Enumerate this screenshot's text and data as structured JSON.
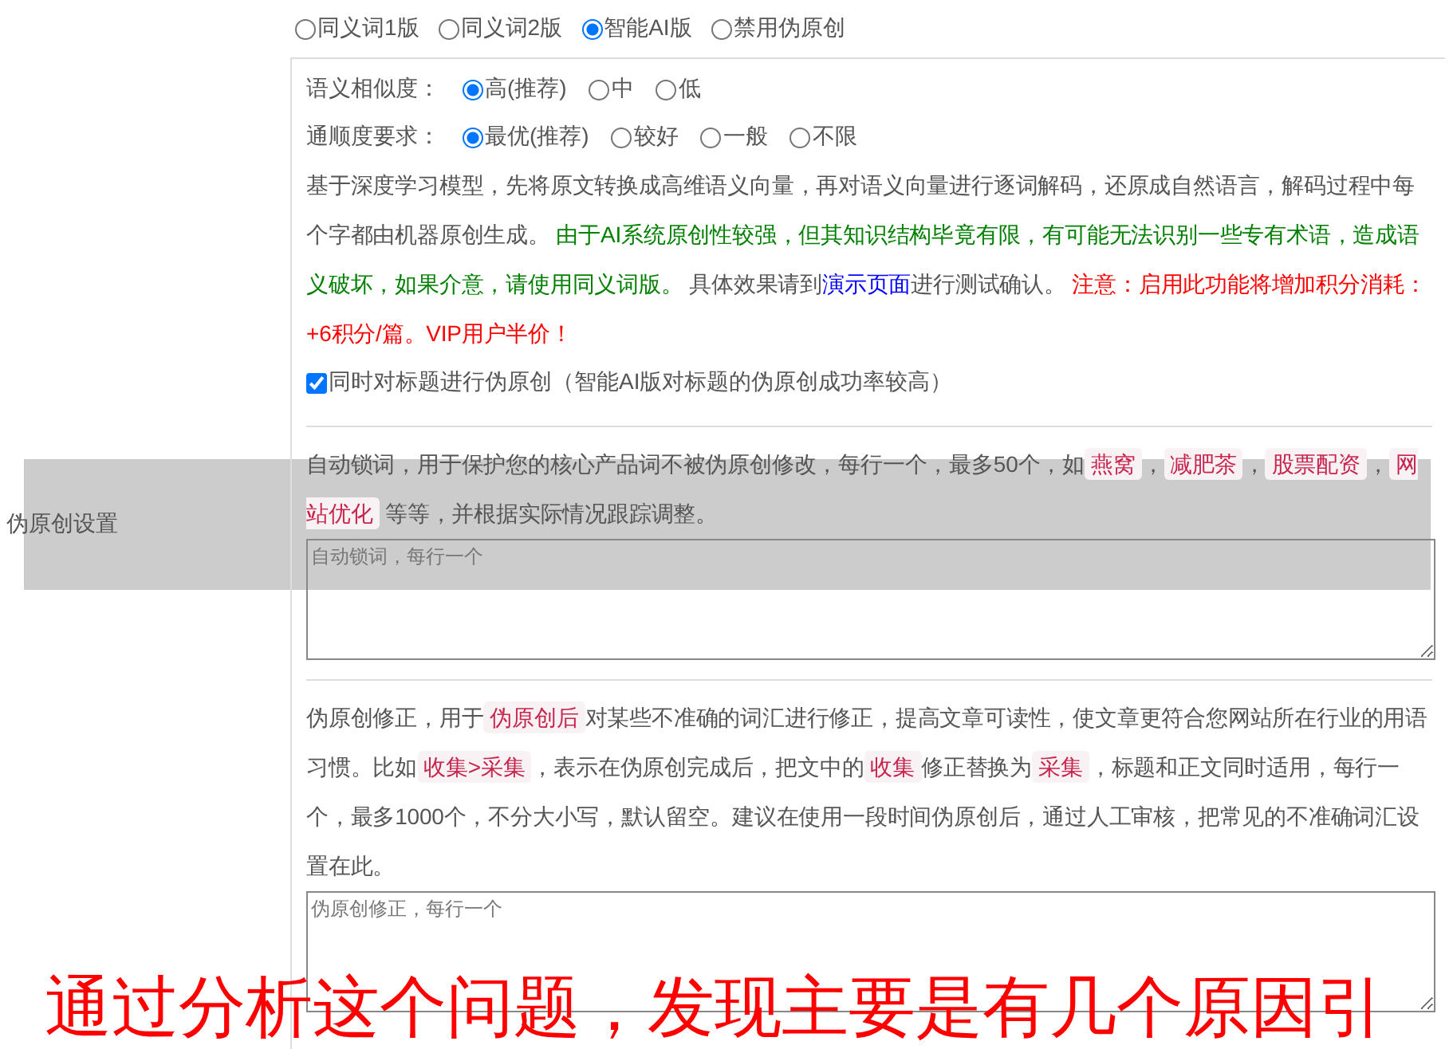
{
  "versions": [
    {
      "label": "同义词1版",
      "selected": false
    },
    {
      "label": "同义词2版",
      "selected": false
    },
    {
      "label": "智能AI版",
      "selected": true
    },
    {
      "label": "禁用伪原创",
      "selected": false
    }
  ],
  "similarity": {
    "label": "语义相似度：",
    "options": [
      {
        "label": "高(推荐)",
        "selected": true
      },
      {
        "label": "中",
        "selected": false
      },
      {
        "label": "低",
        "selected": false
      }
    ]
  },
  "fluency": {
    "label": "通顺度要求：",
    "options": [
      {
        "label": "最优(推荐)",
        "selected": true
      },
      {
        "label": "较好",
        "selected": false
      },
      {
        "label": "一般",
        "selected": false
      },
      {
        "label": "不限",
        "selected": false
      }
    ]
  },
  "ai_description": [
    {
      "kind": "text",
      "text": "基于深度学习模型，先将原文转换成高维语义向量，再对语义向量进行逐词解码，还原成自然语言，解码过程中每个字都由机器原创生成。 "
    },
    {
      "kind": "green",
      "text": "由于AI系统原创性较强，但其知识结构毕竟有限，有可能无法识别一些专有术语，造成语义破坏，如果介意，请使用同义词版。"
    },
    {
      "kind": "text",
      "text": " 具体效果请到"
    },
    {
      "kind": "link",
      "text": "演示页面"
    },
    {
      "kind": "text",
      "text": "进行测试确认。 "
    },
    {
      "kind": "red",
      "text": "注意：启用此功能将增加积分消耗：+6积分/篇。VIP用户半价！"
    }
  ],
  "title_option": {
    "label": "同时对标题进行伪原创（智能AI版对标题的伪原创成功率较高）",
    "checked": true
  },
  "section_label": "伪原创设置",
  "lock_words": {
    "description": [
      {
        "kind": "text",
        "text": "自动锁词，用于保护您的核心产品词不被伪原创修改，每行一个，最多50个，如"
      },
      {
        "kind": "code",
        "text": "燕窝"
      },
      {
        "kind": "text",
        "text": "，"
      },
      {
        "kind": "code",
        "text": "减肥茶"
      },
      {
        "kind": "text",
        "text": "，"
      },
      {
        "kind": "code",
        "text": "股票配资"
      },
      {
        "kind": "text",
        "text": "，"
      },
      {
        "kind": "code",
        "text": "网站优化"
      },
      {
        "kind": "text",
        "text": " 等等，并根据实际情况跟踪调整。"
      }
    ],
    "placeholder": "自动锁词，每行一个"
  },
  "corrections": {
    "description": [
      {
        "kind": "text",
        "text": "伪原创修正，用于"
      },
      {
        "kind": "code",
        "text": "伪原创后"
      },
      {
        "kind": "text",
        "text": "对某些不准确的词汇进行修正，提高文章可读性，使文章更符合您网站所在行业的用语习惯。比如"
      },
      {
        "kind": "code",
        "text": "收集>采集"
      },
      {
        "kind": "text",
        "text": "，表示在伪原创完成后，把文中的"
      },
      {
        "kind": "code",
        "text": "收集"
      },
      {
        "kind": "text",
        "text": "修正替换为"
      },
      {
        "kind": "code",
        "text": "采集"
      },
      {
        "kind": "text",
        "text": "，标题和正文同时适用，每行一个，最多1000个，不分大小写，默认留空。建议在使用一段时间伪原创后，通过人工审核，把常见的不准确词汇设置在此。"
      }
    ],
    "placeholder": "伪原创修正，每行一个"
  },
  "caption": "通过分析这个问题，发现主要是有几个原因引"
}
